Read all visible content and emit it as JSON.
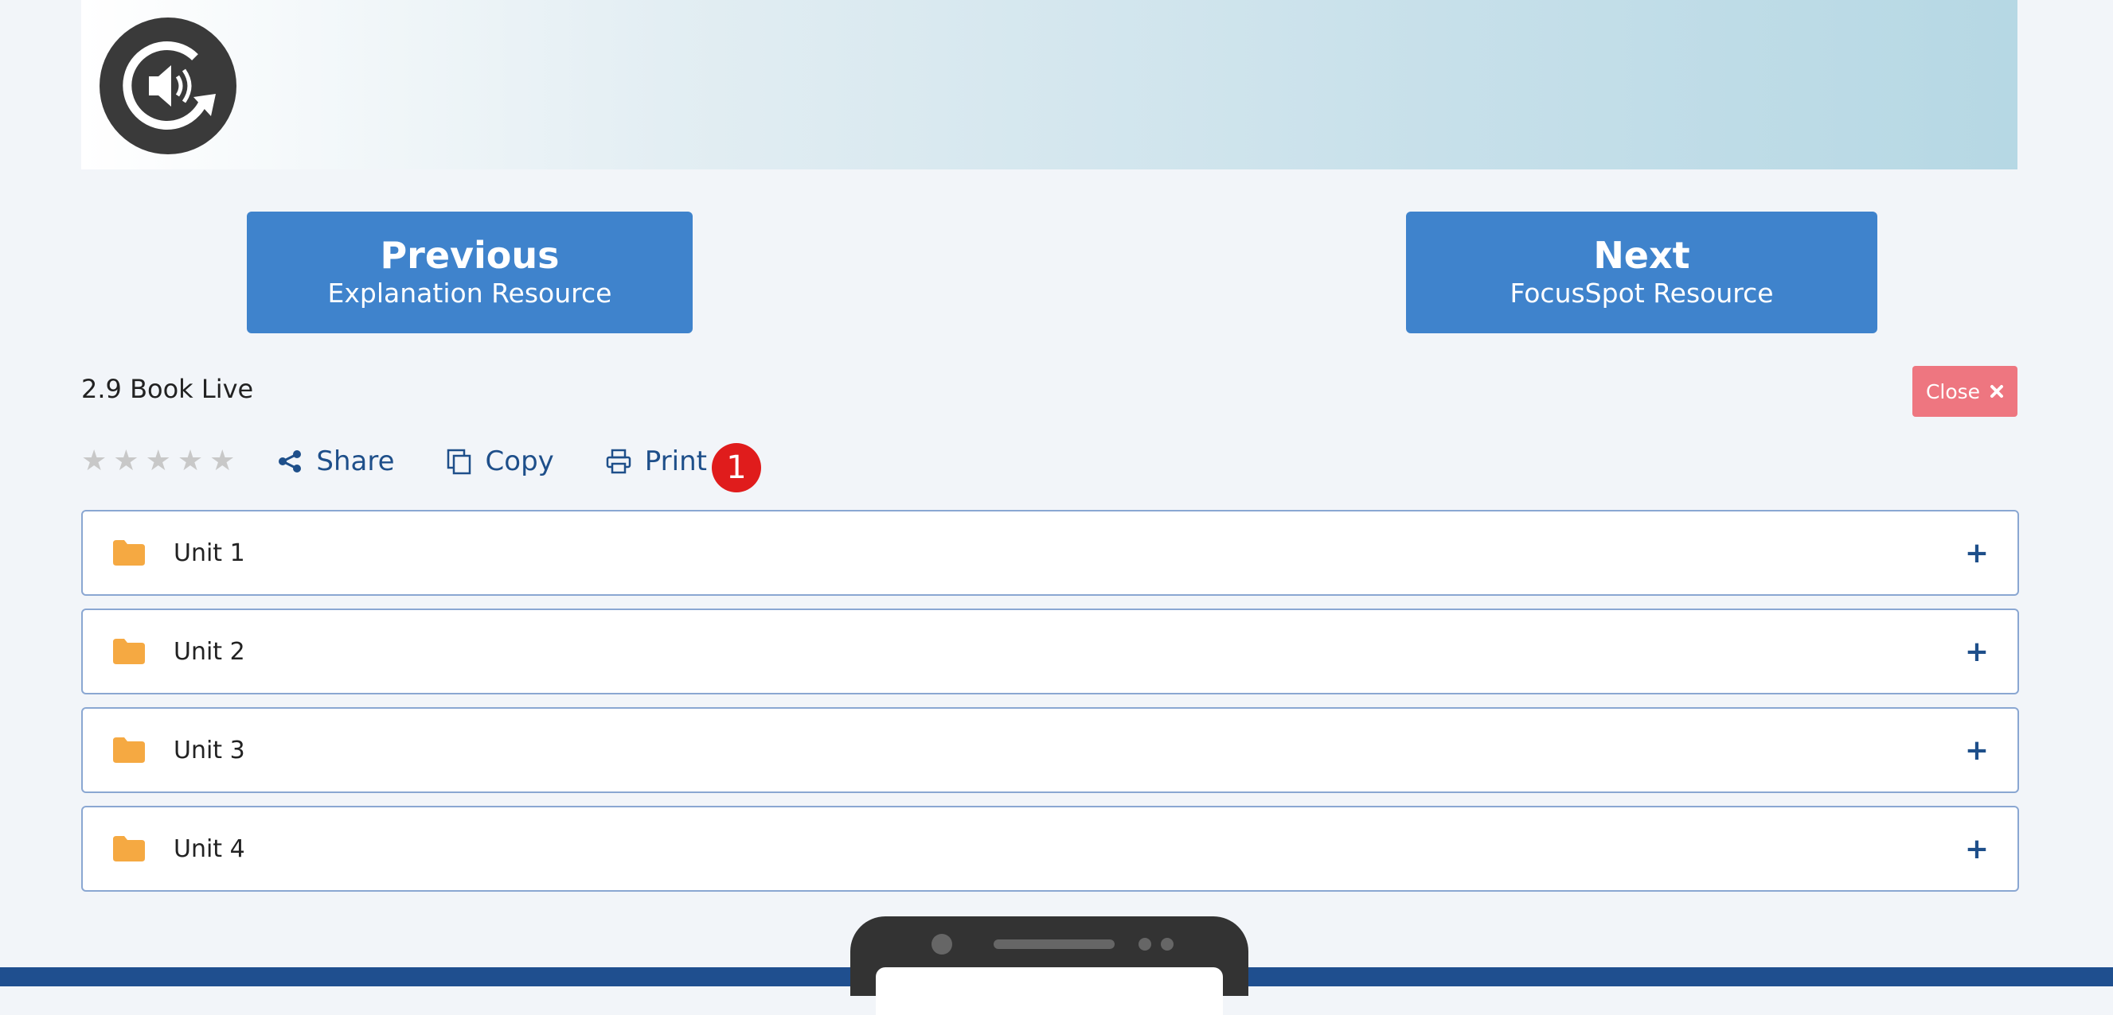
{
  "nav": {
    "previous": {
      "title": "Previous",
      "subtitle": "Explanation Resource"
    },
    "next": {
      "title": "Next",
      "subtitle": "FocusSpot Resource"
    }
  },
  "resource": {
    "title": "2.9 Book Live",
    "close_label": "Close",
    "close_icon": "x-icon"
  },
  "toolbar": {
    "rating": {
      "value": 0,
      "max": 5
    },
    "share_label": "Share",
    "copy_label": "Copy",
    "print_label": "Print",
    "badge": "1"
  },
  "units": [
    {
      "label": "Unit 1",
      "icon": "folder-icon",
      "toggle": "+"
    },
    {
      "label": "Unit 2",
      "icon": "folder-icon",
      "toggle": "+"
    },
    {
      "label": "Unit 3",
      "icon": "folder-icon",
      "toggle": "+"
    },
    {
      "label": "Unit 4",
      "icon": "folder-icon",
      "toggle": "+"
    }
  ],
  "colors": {
    "primary": "#3f83cc",
    "link": "#1e4f8a",
    "close": "#ee7680",
    "badge": "#e01c1c",
    "folder": "#f5a942",
    "footer": "#1f4f8f"
  }
}
